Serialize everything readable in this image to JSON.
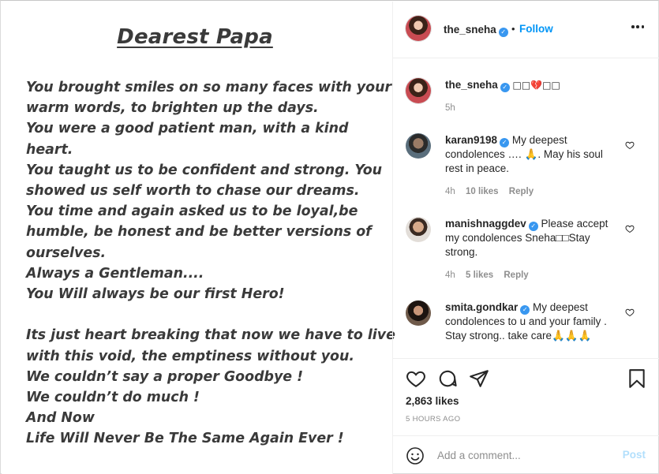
{
  "post_image": {
    "title": "Dearest Papa",
    "lines": [
      "You brought smiles on so many faces with your",
      "warm words, to brighten up the days.",
      "You were a good patient man, with a kind",
      "heart.",
      "You taught us to be confident and strong. You",
      "showed us self worth to chase our dreams.",
      "You time and again asked us to be loyal,be",
      "humble, be honest and be better versions of",
      "ourselves.",
      "Always a Gentleman....",
      "You Will always be our first Hero!",
      "",
      "Its just heart breaking that now we have to live",
      "with this void, the emptiness without you.",
      "We couldn’t say a proper Goodbye !",
      "We couldn’t do much !",
      "And Now",
      "Life Will Never Be The Same Again Ever !"
    ]
  },
  "header": {
    "username": "the_sneha",
    "separator": "•",
    "follow_label": "Follow",
    "more_icon": "more-options-icon"
  },
  "caption": {
    "username": "the_sneha",
    "text": "□□💔□□",
    "time": "5h"
  },
  "comments": [
    {
      "username": "karan9198",
      "text": "My deepest condolences …. 🙏. May his soul rest in peace.",
      "time": "4h",
      "likes": "10 likes",
      "reply": "Reply"
    },
    {
      "username": "manishnaggdev",
      "text": "Please accept my condolences Sneha□□Stay strong.",
      "time": "4h",
      "likes": "5 likes",
      "reply": "Reply"
    },
    {
      "username": "smita.gondkar",
      "text": "My deepest condolences to u and your family . Stay strong.. take care🙏🙏🙏",
      "time": "",
      "likes": "",
      "reply": ""
    }
  ],
  "actions": {
    "likes": "2,863 likes",
    "time_ago": "5 HOURS AGO"
  },
  "add_comment": {
    "placeholder": "Add a comment...",
    "post_label": "Post"
  },
  "colors": {
    "accent": "#0095f6",
    "verified": "#3897f0",
    "muted": "#8e8e8e",
    "post_disabled": "#b2dffc"
  }
}
